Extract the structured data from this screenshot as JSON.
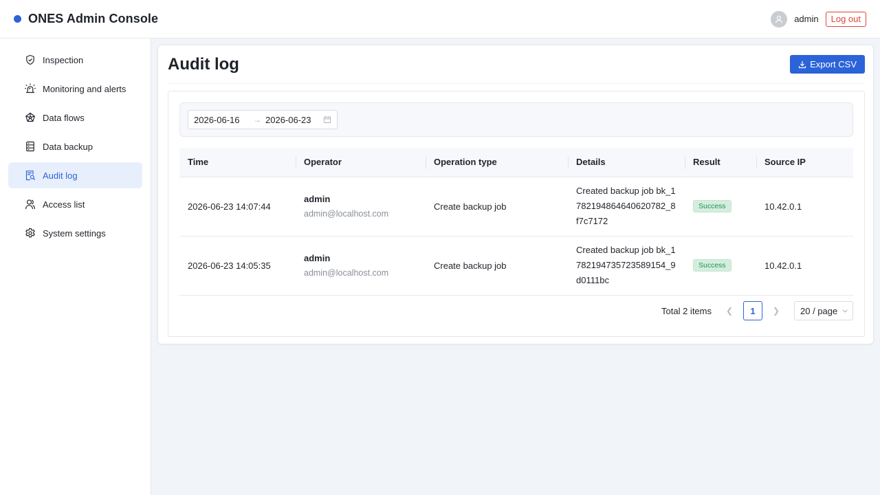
{
  "header": {
    "app_title": "ONES Admin Console",
    "brand_color": "#2b63d9",
    "username": "admin",
    "logout_label": "Log out"
  },
  "sidebar": {
    "items": [
      {
        "label": "Inspection",
        "icon": "shield-check-icon",
        "active": false
      },
      {
        "label": "Monitoring and alerts",
        "icon": "alarm-icon",
        "active": false
      },
      {
        "label": "Data flows",
        "icon": "network-icon",
        "active": false
      },
      {
        "label": "Data backup",
        "icon": "database-icon",
        "active": false
      },
      {
        "label": "Audit log",
        "icon": "audit-search-icon",
        "active": true
      },
      {
        "label": "Access list",
        "icon": "users-icon",
        "active": false
      },
      {
        "label": "System settings",
        "icon": "gear-icon",
        "active": false
      }
    ]
  },
  "main": {
    "title": "Audit log",
    "export_label": "Export CSV",
    "filter": {
      "start_date": "2026-06-16",
      "end_date": "2026-06-23",
      "separator": "→"
    },
    "table": {
      "columns": [
        "Time",
        "Operator",
        "Operation type",
        "Details",
        "Result",
        "Source IP"
      ],
      "rows": [
        {
          "time": "2026-06-23 14:07:44",
          "operator_name": "admin",
          "operator_email": "admin@localhost.com",
          "operation_type": "Create backup job",
          "details": "Created backup job bk_1782194864640620782_8f7c7172",
          "result": "Success",
          "source_ip": "10.42.0.1"
        },
        {
          "time": "2026-06-23 14:05:35",
          "operator_name": "admin",
          "operator_email": "admin@localhost.com",
          "operation_type": "Create backup job",
          "details": "Created backup job bk_1782194735723589154_9d0111bc",
          "result": "Success",
          "source_ip": "10.42.0.1"
        }
      ]
    },
    "pagination": {
      "total_label": "Total 2 items",
      "current_page": "1",
      "page_size_label": "20 / page"
    }
  },
  "colors": {
    "accent": "#2b63d9",
    "danger": "#e0443a",
    "success_bg": "#d4eedd",
    "success_text": "#21915c"
  }
}
